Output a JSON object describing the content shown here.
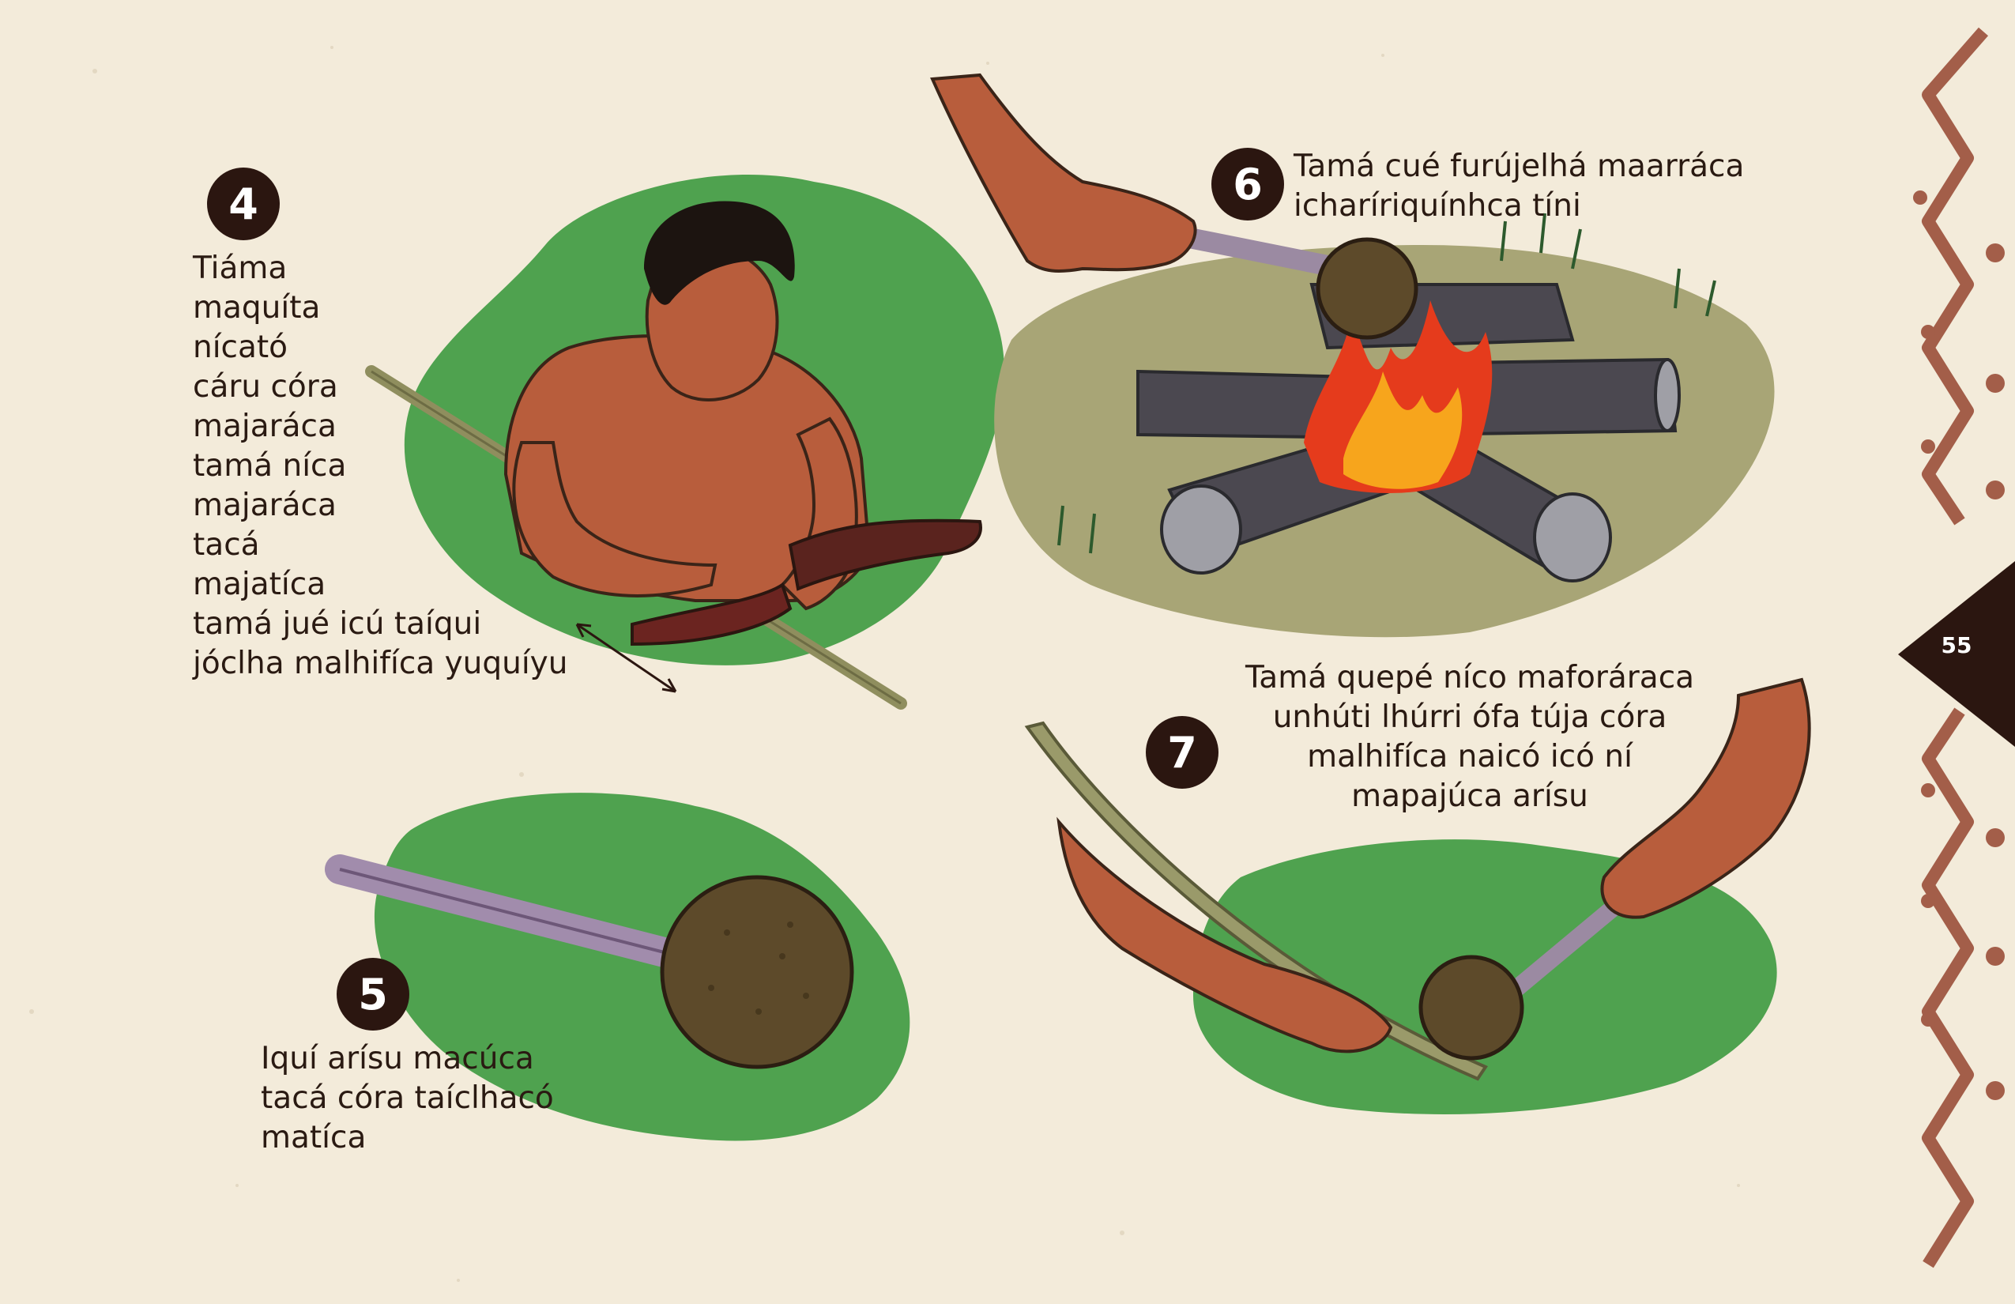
{
  "page_number": "55",
  "colors": {
    "paper": "#f3ebda",
    "green_blob": "#4fa24f",
    "ash_ground": "#a8a576",
    "skin": "#b85d3c",
    "dark_brown": "#2b1610",
    "border_pattern": "#a35e49"
  },
  "steps": [
    {
      "number": "4",
      "lines": [
        "Tiáma",
        "maquíta",
        "nícató",
        "cáru córa",
        "majaráca",
        "tamá níca",
        "majaráca",
        "tacá",
        "majatíca",
        "tamá jué icú taíqui",
        "jóclha malhifíca yuquíyu"
      ]
    },
    {
      "number": "5",
      "lines": [
        "Iquí arísu macúca",
        "tacá córa taíclhacó",
        "matíca"
      ]
    },
    {
      "number": "6",
      "lines": [
        "Tamá cué furújelhá maarráca",
        "icharíriquínhca tíni"
      ]
    },
    {
      "number": "7",
      "lines": [
        "Tamá quepé níco maforáraca",
        "unhúti lhúrri ófa túja córa",
        "malhifíca naicó icó ní",
        "mapajúca arísu"
      ]
    }
  ]
}
